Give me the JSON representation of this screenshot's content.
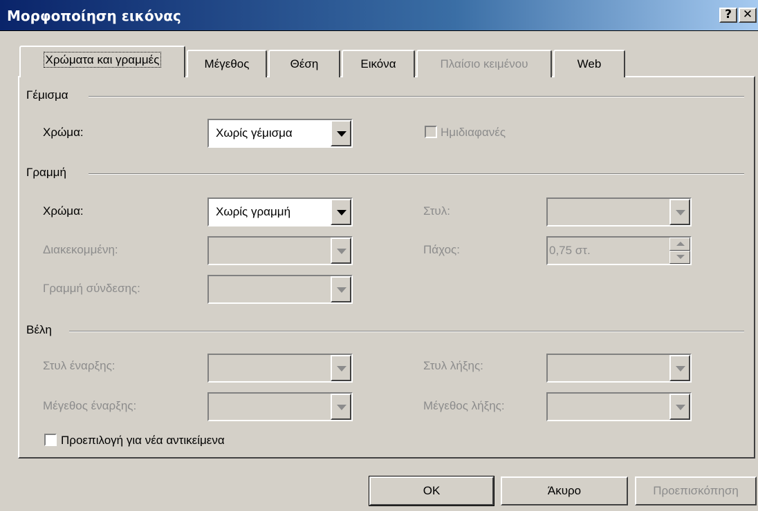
{
  "window": {
    "title": "Μορφοποίηση εικόνας",
    "help_button": "?",
    "close_button": "✕"
  },
  "tabs": [
    {
      "label": "Χρώματα και γραμμές",
      "active": true,
      "enabled": true
    },
    {
      "label": "Μέγεθος",
      "active": false,
      "enabled": true
    },
    {
      "label": "Θέση",
      "active": false,
      "enabled": true
    },
    {
      "label": "Εικόνα",
      "active": false,
      "enabled": true
    },
    {
      "label": "Πλαίσιο κειμένου",
      "active": false,
      "enabled": false
    },
    {
      "label": "Web",
      "active": false,
      "enabled": true
    }
  ],
  "fill": {
    "section_label": "Γέμισμα",
    "color_label": "Χρώμα:",
    "color_value": "Χωρίς γέμισμα",
    "semitransparent_label": "Ημιδιαφανές",
    "semitransparent_checked": false
  },
  "line": {
    "section_label": "Γραμμή",
    "color_label": "Χρώμα:",
    "color_value": "Χωρίς γραμμή",
    "dashed_label": "Διακεκομμένη:",
    "dashed_value": "",
    "connector_label": "Γραμμή σύνδεσης:",
    "connector_value": "",
    "style_label": "Στυλ:",
    "style_value": "",
    "weight_label": "Πάχος:",
    "weight_value": "0,75 στ."
  },
  "arrows": {
    "section_label": "Βέλη",
    "begin_style_label": "Στυλ έναρξης:",
    "begin_style_value": "",
    "begin_size_label": "Μέγεθος έναρξης:",
    "begin_size_value": "",
    "end_style_label": "Στυλ λήξης:",
    "end_style_value": "",
    "end_size_label": "Μέγεθος λήξης:",
    "end_size_value": ""
  },
  "default_for_new": {
    "label": "Προεπιλογή για νέα αντικείμενα",
    "checked": false
  },
  "buttons": {
    "ok": "OK",
    "cancel": "Άκυρο",
    "preview": "Προεπισκόπηση"
  },
  "colors": {
    "titlebar_start": "#0a246a",
    "titlebar_end": "#a6caf0",
    "face": "#d4d0c8",
    "disabled_text": "#8c8c8c"
  }
}
